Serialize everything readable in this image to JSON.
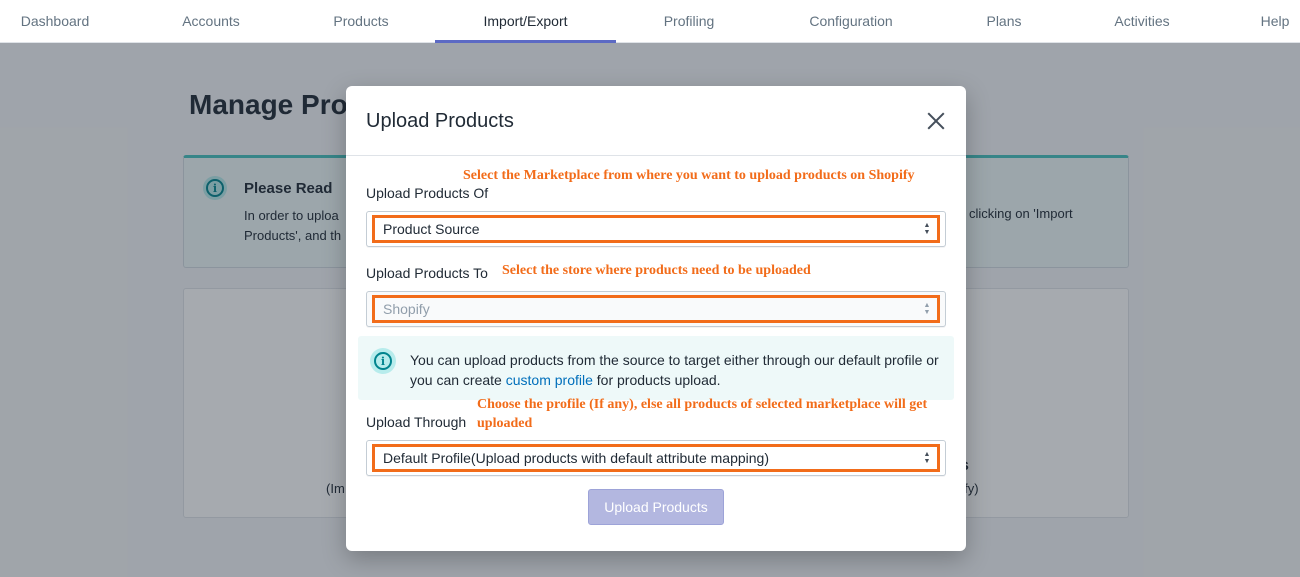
{
  "nav": {
    "tabs": [
      {
        "label": "Dashboard"
      },
      {
        "label": "Accounts"
      },
      {
        "label": "Products"
      },
      {
        "label": "Import/Export"
      },
      {
        "label": "Profiling"
      },
      {
        "label": "Configuration"
      },
      {
        "label": "Plans"
      },
      {
        "label": "Activities"
      },
      {
        "label": "Help"
      }
    ],
    "active": "Import/Export"
  },
  "background": {
    "page_title": "Manage Prod",
    "banner": {
      "title": "Please Read",
      "text_left_line1": "In order to uploa",
      "text_left_line2": "Products', and th",
      "text_right": "clicking on 'Import"
    },
    "card": {
      "left_sub": "(Im",
      "right_bold": "s",
      "right_sub": "pify)"
    }
  },
  "modal": {
    "title": "Upload Products",
    "fields": [
      {
        "label": "Upload Products Of",
        "value": "Product Source",
        "disabled": false
      },
      {
        "label": "Upload Products To",
        "value": "Shopify",
        "disabled": true
      },
      {
        "label": "Upload Through",
        "value": "Default Profile(Upload products with default attribute mapping)",
        "disabled": false
      }
    ],
    "info": {
      "text_before": "You can upload products from the source to target either through our default profile or you can create ",
      "link": "custom profile",
      "text_after": " for products upload."
    },
    "submit_label": "Upload Products"
  },
  "annotations": {
    "note1": "Select the Marketplace from where you want to upload products on Shopify",
    "note2": "Select the store where products need to be uploaded",
    "note3": "Choose the profile (If any), else all products of selected marketplace will get uploaded"
  },
  "colors": {
    "accent": "#5c6ac4",
    "annotation": "#f26c1a",
    "info_bg": "#eef9f9",
    "link": "#006fbb"
  }
}
